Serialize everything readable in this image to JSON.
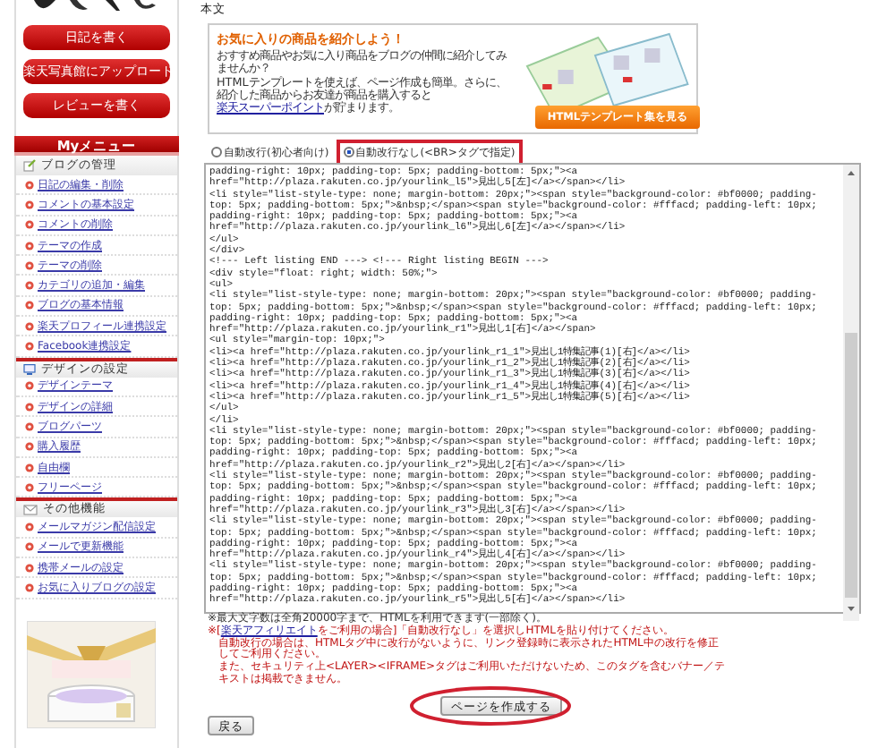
{
  "sidebar": {
    "buttons": [
      "日記を書く",
      "楽天写真館にアップロード",
      "レビューを書く"
    ],
    "menu_title": "Myメニュー",
    "sections": [
      {
        "kind": "blog",
        "title": "ブログの管理",
        "items": [
          "日記の編集・削除",
          "コメントの基本設定",
          "コメントの削除",
          "テーマの作成",
          "テーマの削除",
          "カテゴリの追加・編集",
          "ブログの基本情報",
          "楽天プロフィール連携設定",
          "Facebook連携設定"
        ]
      },
      {
        "kind": "design",
        "title": "デザインの設定",
        "items": [
          "デザインテーマ",
          "デザインの詳細",
          "ブログパーツ",
          "購入履歴",
          "自由欄",
          "フリーページ"
        ]
      },
      {
        "kind": "other",
        "title": "その他機能",
        "items": [
          "メールマガジン配信設定",
          "メールで更新機能",
          "携帯メールの設定",
          "お気に入りブログの設定"
        ]
      }
    ]
  },
  "main": {
    "heading": "本文",
    "promo": {
      "title": "お気に入りの商品を紹介しよう！",
      "intro": "おすすめ商品やお気に入り商品をブログの仲間に紹介してみませんか？",
      "text": "HTMLテンプレートを使えば、ページ作成も簡単。さらに、紹介した商品からお友達が商品を購入すると",
      "link": "楽天スーパーポイント",
      "text_after": "が貯まります。",
      "button": "HTMLテンプレート集を見る"
    },
    "line_modes": [
      {
        "label": "自動改行(初心者向け)",
        "selected": false,
        "highlighted": false
      },
      {
        "label": "自動改行なし(<BR>タグで指定)",
        "selected": true,
        "highlighted": true
      }
    ],
    "code_lines": [
      "padding-right: 10px; padding-top: 5px; padding-bottom: 5px;\"><a",
      "href=\"http://plaza.rakuten.co.jp/yourlink_l5\">見出し5[左]</a></span></li>",
      "<li style=\"list-style-type: none; margin-bottom: 20px;\"><span style=\"background-color: #bf0000; padding-",
      "top: 5px; padding-bottom: 5px;\">&nbsp;</span><span style=\"background-color: #fffacd; padding-left: 10px;",
      "padding-right: 10px; padding-top: 5px; padding-bottom: 5px;\"><a",
      "href=\"http://plaza.rakuten.co.jp/yourlink_l6\">見出し6[左]</a></span></li>",
      "</ul>",
      "</div>",
      "<!--- Left listing END ---> <!--- Right listing BEGIN --->",
      "<div style=\"float: right; width: 50%;\">",
      "<ul>",
      "<li style=\"list-style-type: none; margin-bottom: 20px;\"><span style=\"background-color: #bf0000; padding-",
      "top: 5px; padding-bottom: 5px;\">&nbsp;</span><span style=\"background-color: #fffacd; padding-left: 10px;",
      "padding-right: 10px; padding-top: 5px; padding-bottom: 5px;\"><a",
      "href=\"http://plaza.rakuten.co.jp/yourlink_r1\">見出し1[右]</a></span>",
      "<ul style=\"margin-top: 10px;\">",
      "<li><a href=\"http://plaza.rakuten.co.jp/yourlink_r1_1\">見出し1特集記事(1)[右]</a></li>",
      "<li><a href=\"http://plaza.rakuten.co.jp/yourlink_r1_2\">見出し1特集記事(2)[右]</a></li>",
      "<li><a href=\"http://plaza.rakuten.co.jp/yourlink_r1_3\">見出し1特集記事(3)[右]</a></li>",
      "<li><a href=\"http://plaza.rakuten.co.jp/yourlink_r1_4\">見出し1特集記事(4)[右]</a></li>",
      "<li><a href=\"http://plaza.rakuten.co.jp/yourlink_r1_5\">見出し1特集記事(5)[右]</a></li>",
      "</ul>",
      "</li>",
      "<li style=\"list-style-type: none; margin-bottom: 20px;\"><span style=\"background-color: #bf0000; padding-",
      "top: 5px; padding-bottom: 5px;\">&nbsp;</span><span style=\"background-color: #fffacd; padding-left: 10px;",
      "padding-right: 10px; padding-top: 5px; padding-bottom: 5px;\"><a",
      "href=\"http://plaza.rakuten.co.jp/yourlink_r2\">見出し2[右]</a></span></li>",
      "<li style=\"list-style-type: none; margin-bottom: 20px;\"><span style=\"background-color: #bf0000; padding-",
      "top: 5px; padding-bottom: 5px;\">&nbsp;</span><span style=\"background-color: #fffacd; padding-left: 10px;",
      "padding-right: 10px; padding-top: 5px; padding-bottom: 5px;\"><a",
      "href=\"http://plaza.rakuten.co.jp/yourlink_r3\">見出し3[右]</a></span></li>",
      "<li style=\"list-style-type: none; margin-bottom: 20px;\"><span style=\"background-color: #bf0000; padding-",
      "top: 5px; padding-bottom: 5px;\">&nbsp;</span><span style=\"background-color: #fffacd; padding-left: 10px;",
      "padding-right: 10px; padding-top: 5px; padding-bottom: 5px;\"><a",
      "href=\"http://plaza.rakuten.co.jp/yourlink_r4\">見出し4[右]</a></span></li>",
      "<li style=\"list-style-type: none; margin-bottom: 20px;\"><span style=\"background-color: #bf0000; padding-",
      "top: 5px; padding-bottom: 5px;\">&nbsp;</span><span style=\"background-color: #fffacd; padding-left: 10px;",
      "padding-right: 10px; padding-top: 5px; padding-bottom: 5px;\"><a",
      "href=\"http://plaza.rakuten.co.jp/yourlink_r5\">見出し5[右]</a></span></li>"
    ],
    "notes": [
      {
        "kind": "info",
        "text": "※最大文字数は全角20000字まで、HTMLを利用できます(一部除く)。"
      },
      {
        "kind": "warning",
        "prefix": "※[",
        "link": "楽天アフィリエイト",
        "text": "をご利用の場合]「自動改行なし」を選択しHTMLを貼り付けてください。"
      },
      {
        "kind": "continued",
        "text": "自動改行の場合は、HTMLタグ中に改行がないように、リンク登録時に表示されたHTML中の改行を修正してご利用ください。"
      },
      {
        "kind": "continued",
        "text": "また、セキュリティ上<LAYER><IFRAME>タグはご利用いただけないため、このタグを含むバナー／テキストは掲載できません。"
      }
    ],
    "actions": [
      {
        "kind": "submit",
        "label": "ページを作成する",
        "highlighted": true
      },
      {
        "kind": "back",
        "label": "戻る",
        "highlighted": false
      }
    ]
  }
}
